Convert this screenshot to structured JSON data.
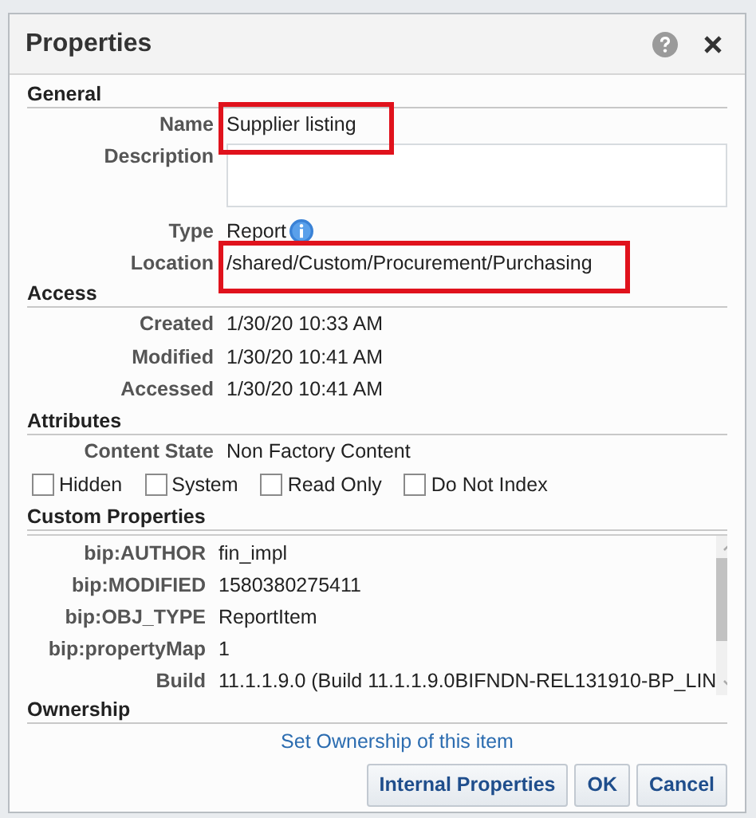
{
  "window": {
    "title": "Properties"
  },
  "general": {
    "heading": "General",
    "fields": [
      {
        "label": "Name",
        "kind": "text",
        "value": "Supplier listing",
        "highlighted": true
      },
      {
        "label": "Description",
        "kind": "textarea"
      },
      {
        "label": "Type",
        "kind": "info",
        "value": "Report"
      },
      {
        "label": "Location",
        "kind": "text",
        "value": "/shared/Custom/Procurement/Purchasing",
        "highlighted": true
      }
    ]
  },
  "access": {
    "heading": "Access",
    "fields": [
      {
        "label": "Created",
        "value": "1/30/20 10:33 AM"
      },
      {
        "label": "Modified",
        "value": "1/30/20 10:41 AM"
      },
      {
        "label": "Accessed",
        "value": "1/30/20 10:41 AM"
      }
    ]
  },
  "attributes": {
    "heading": "Attributes",
    "content_state": {
      "label": "Content State",
      "value": "Non Factory Content"
    },
    "checkboxes": [
      {
        "label": "Hidden",
        "checked": false
      },
      {
        "label": "System",
        "checked": false
      },
      {
        "label": "Read Only",
        "checked": false
      },
      {
        "label": "Do Not Index",
        "checked": false
      }
    ]
  },
  "custom_properties": {
    "heading": "Custom Properties",
    "rows": [
      {
        "name": "bip:AUTHOR",
        "value": "fin_impl"
      },
      {
        "name": "bip:MODIFIED",
        "value": "1580380275411"
      },
      {
        "name": "bip:OBJ_TYPE",
        "value": "ReportItem"
      },
      {
        "name": "bip:propertyMap",
        "value": "1"
      },
      {
        "name": "Build",
        "value": "11.1.1.9.0 (Build 11.1.1.9.0BIFNDN-REL131910-BP_LIN"
      }
    ]
  },
  "ownership": {
    "heading": "Ownership",
    "link": "Set Ownership of this item"
  },
  "buttons": [
    "Internal Properties",
    "OK",
    "Cancel"
  ]
}
